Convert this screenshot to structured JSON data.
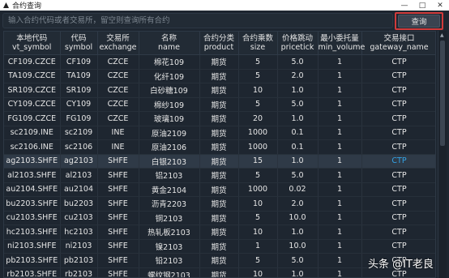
{
  "window": {
    "title": "合约查询",
    "icon": "app-logo-icon",
    "buttons": [
      "—",
      "□",
      "✕"
    ]
  },
  "search": {
    "placeholder": "输入合约代码或者交易所，留空则查询所有合约",
    "query_label": "查询"
  },
  "table": {
    "headers": [
      [
        "本地代码",
        "vt_symbol"
      ],
      [
        "代码",
        "symbol"
      ],
      [
        "交易所",
        "exchange"
      ],
      [
        "名称",
        "name"
      ],
      [
        "合约分类",
        "product"
      ],
      [
        "合约乘数",
        "size"
      ],
      [
        "价格跳动",
        "pricetick"
      ],
      [
        "最小委托量",
        "min_volume"
      ],
      [
        "交易接口",
        "gateway_name"
      ]
    ],
    "rows": [
      [
        "CF109.CZCE",
        "CF109",
        "CZCE",
        "棉花109",
        "期货",
        "5",
        "5.0",
        "1",
        "CTP"
      ],
      [
        "TA109.CZCE",
        "TA109",
        "CZCE",
        "化纤109",
        "期货",
        "5",
        "2.0",
        "1",
        "CTP"
      ],
      [
        "SR109.CZCE",
        "SR109",
        "CZCE",
        "白砂糖109",
        "期货",
        "10",
        "1.0",
        "1",
        "CTP"
      ],
      [
        "CY109.CZCE",
        "CY109",
        "CZCE",
        "棉纱109",
        "期货",
        "5",
        "5.0",
        "1",
        "CTP"
      ],
      [
        "FG109.CZCE",
        "FG109",
        "CZCE",
        "玻璃109",
        "期货",
        "20",
        "1.0",
        "1",
        "CTP"
      ],
      [
        "sc2109.INE",
        "sc2109",
        "INE",
        "原油2109",
        "期货",
        "1000",
        "0.1",
        "1",
        "CTP"
      ],
      [
        "sc2106.INE",
        "sc2106",
        "INE",
        "原油2106",
        "期货",
        "1000",
        "0.1",
        "1",
        "CTP"
      ],
      [
        "ag2103.SHFE",
        "ag2103",
        "SHFE",
        "白银2103",
        "期货",
        "15",
        "1.0",
        "1",
        "CTP"
      ],
      [
        "al2103.SHFE",
        "al2103",
        "SHFE",
        "铝2103",
        "期货",
        "5",
        "5.0",
        "1",
        "CTP"
      ],
      [
        "au2104.SHFE",
        "au2104",
        "SHFE",
        "黄金2104",
        "期货",
        "1000",
        "0.02",
        "1",
        "CTP"
      ],
      [
        "bu2203.SHFE",
        "bu2203",
        "SHFE",
        "沥青2203",
        "期货",
        "10",
        "2.0",
        "1",
        "CTP"
      ],
      [
        "cu2103.SHFE",
        "cu2103",
        "SHFE",
        "铜2103",
        "期货",
        "5",
        "10.0",
        "1",
        "CTP"
      ],
      [
        "hc2103.SHFE",
        "hc2103",
        "SHFE",
        "热轧板2103",
        "期货",
        "10",
        "1.0",
        "1",
        "CTP"
      ],
      [
        "ni2103.SHFE",
        "ni2103",
        "SHFE",
        "镍2103",
        "期货",
        "1",
        "10.0",
        "1",
        "CTP"
      ],
      [
        "pb2103.SHFE",
        "pb2103",
        "SHFE",
        "铅2103",
        "期货",
        "5",
        "5.0",
        "1",
        "CTP"
      ],
      [
        "rb2103.SHFE",
        "rb2103",
        "SHFE",
        "螺纹钢2103",
        "期货",
        "10",
        "1.0",
        "1",
        "CTP"
      ]
    ],
    "selected_row_index": 7
  },
  "watermark": "头条 @IT老良",
  "colors": {
    "background": "#1e2630",
    "selected_row": "#2f3a47",
    "selected_text": "#33a3e6",
    "highlight_border": "#d13b3b"
  }
}
